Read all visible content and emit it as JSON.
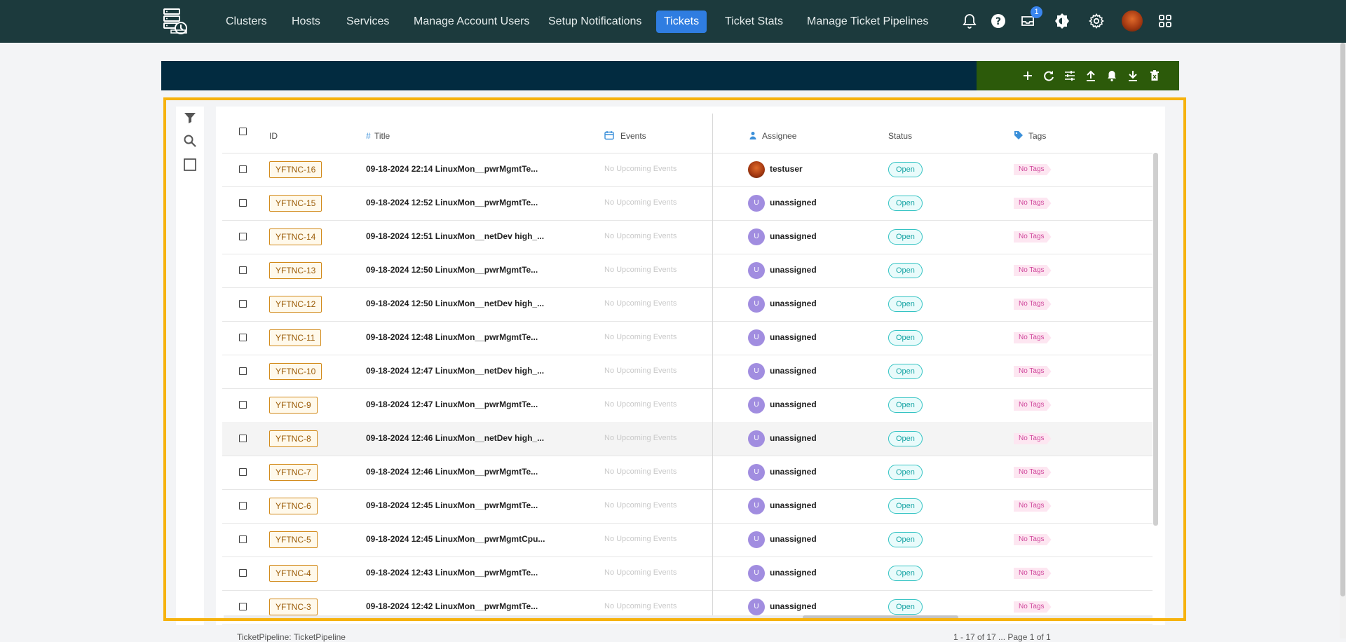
{
  "nav": {
    "items": [
      "Clusters",
      "Hosts",
      "Services",
      "Manage Account Users",
      "Setup Notifications",
      "Tickets",
      "Ticket Stats",
      "Manage Ticket Pipelines"
    ],
    "active": "Tickets",
    "inbox_badge": "1",
    "icons": [
      "bell-icon",
      "help-icon",
      "inbox-icon",
      "theme-icon",
      "gear-icon",
      "avatar",
      "apps-grid-icon"
    ]
  },
  "toolbar": {
    "icons": [
      "plus-icon",
      "refresh-icon",
      "settings-sliders-icon",
      "upload-icon",
      "bell-icon",
      "download-icon",
      "delete-icon"
    ]
  },
  "left_rail": {
    "icons": [
      "filter-icon",
      "search-icon",
      "square-icon"
    ]
  },
  "table": {
    "columns": {
      "id": "ID",
      "title": "Title",
      "events": "Events",
      "assignee": "Assignee",
      "status": "Status",
      "tags": "Tags"
    },
    "rows": [
      {
        "id": "YFTNC-16",
        "title": "09-18-2024 22:14 LinuxMon__pwrMgmtTe...",
        "events": "No Upcoming Events",
        "avatar": "",
        "assignee": "testuser",
        "status": "Open",
        "tags": "No Tags"
      },
      {
        "id": "YFTNC-15",
        "title": "09-18-2024 12:52 LinuxMon__pwrMgmtTe...",
        "events": "No Upcoming Events",
        "avatar": "U",
        "assignee": "unassigned",
        "status": "Open",
        "tags": "No Tags"
      },
      {
        "id": "YFTNC-14",
        "title": "09-18-2024 12:51 LinuxMon__netDev high_...",
        "events": "No Upcoming Events",
        "avatar": "U",
        "assignee": "unassigned",
        "status": "Open",
        "tags": "No Tags"
      },
      {
        "id": "YFTNC-13",
        "title": "09-18-2024 12:50 LinuxMon__pwrMgmtTe...",
        "events": "No Upcoming Events",
        "avatar": "U",
        "assignee": "unassigned",
        "status": "Open",
        "tags": "No Tags"
      },
      {
        "id": "YFTNC-12",
        "title": "09-18-2024 12:50 LinuxMon__netDev high_...",
        "events": "No Upcoming Events",
        "avatar": "U",
        "assignee": "unassigned",
        "status": "Open",
        "tags": "No Tags"
      },
      {
        "id": "YFTNC-11",
        "title": "09-18-2024 12:48 LinuxMon__pwrMgmtTe...",
        "events": "No Upcoming Events",
        "avatar": "U",
        "assignee": "unassigned",
        "status": "Open",
        "tags": "No Tags"
      },
      {
        "id": "YFTNC-10",
        "title": "09-18-2024 12:47 LinuxMon__netDev high_...",
        "events": "No Upcoming Events",
        "avatar": "U",
        "assignee": "unassigned",
        "status": "Open",
        "tags": "No Tags"
      },
      {
        "id": "YFTNC-9",
        "title": "09-18-2024 12:47 LinuxMon__pwrMgmtTe...",
        "events": "No Upcoming Events",
        "avatar": "U",
        "assignee": "unassigned",
        "status": "Open",
        "tags": "No Tags"
      },
      {
        "id": "YFTNC-8",
        "title": "09-18-2024 12:46 LinuxMon__netDev high_...",
        "events": "No Upcoming Events",
        "avatar": "U",
        "assignee": "unassigned",
        "status": "Open",
        "tags": "No Tags"
      },
      {
        "id": "YFTNC-7",
        "title": "09-18-2024 12:46 LinuxMon__pwrMgmtTe...",
        "events": "No Upcoming Events",
        "avatar": "U",
        "assignee": "unassigned",
        "status": "Open",
        "tags": "No Tags"
      },
      {
        "id": "YFTNC-6",
        "title": "09-18-2024 12:45 LinuxMon__pwrMgmtTe...",
        "events": "No Upcoming Events",
        "avatar": "U",
        "assignee": "unassigned",
        "status": "Open",
        "tags": "No Tags"
      },
      {
        "id": "YFTNC-5",
        "title": "09-18-2024 12:45 LinuxMon__pwrMgmtCpu...",
        "events": "No Upcoming Events",
        "avatar": "U",
        "assignee": "unassigned",
        "status": "Open",
        "tags": "No Tags"
      },
      {
        "id": "YFTNC-4",
        "title": "09-18-2024 12:43 LinuxMon__pwrMgmtTe...",
        "events": "No Upcoming Events",
        "avatar": "U",
        "assignee": "unassigned",
        "status": "Open",
        "tags": "No Tags"
      },
      {
        "id": "YFTNC-3",
        "title": "09-18-2024 12:42 LinuxMon__pwrMgmtTe...",
        "events": "No Upcoming Events",
        "avatar": "U",
        "assignee": "unassigned",
        "status": "Open",
        "tags": "No Tags"
      }
    ]
  },
  "footer": {
    "left": "TicketPipeline: TicketPipeline",
    "right": "1 - 17 of 17 ... Page 1 of 1"
  },
  "colors": {
    "topbar": "#1c3a3d",
    "nav_active": "#2f7de1",
    "toolbar_dark": "#022b40",
    "toolbar_green": "#2c5a0a",
    "highlight": "#f6b20d",
    "id_tag": "#d28a1a",
    "status_open": "#33c3c3",
    "tags": "#d0479c"
  }
}
